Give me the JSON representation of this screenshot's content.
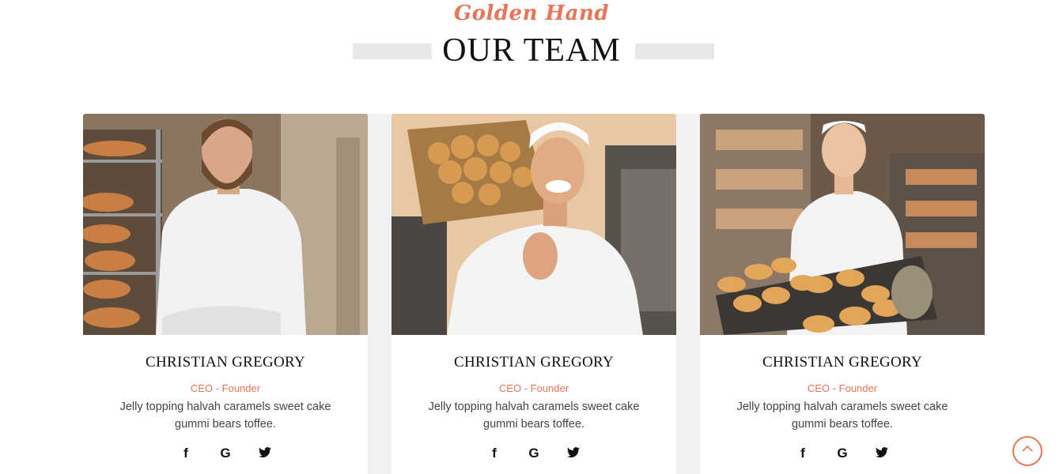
{
  "header": {
    "script_title": "Golden Hand",
    "title": "OUR TEAM"
  },
  "team": [
    {
      "name": "CHRISTIAN GREGORY",
      "role": "CEO - Founder",
      "bio": "Jelly topping halvah caramels sweet cake gummi bears toffee.",
      "photo": "bearded-baker-with-bread-racks-photo",
      "socials": [
        "facebook-icon",
        "google-icon",
        "twitter-icon"
      ]
    },
    {
      "name": "CHRISTIAN GREGORY",
      "role": "CEO - Founder",
      "bio": "Jelly topping halvah caramels sweet cake gummi bears toffee.",
      "photo": "smiling-baker-with-bread-basket-photo",
      "socials": [
        "facebook-icon",
        "google-icon",
        "twitter-icon"
      ]
    },
    {
      "name": "CHRISTIAN GREGORY",
      "role": "CEO - Founder",
      "bio": "Jelly topping halvah caramels sweet cake gummi bears toffee.",
      "photo": "female-baker-with-bun-tray-photo",
      "socials": [
        "facebook-icon",
        "google-icon",
        "twitter-icon"
      ]
    }
  ],
  "social_glyphs": {
    "facebook": "f",
    "google": "G"
  },
  "colors": {
    "accent": "#e8755a",
    "title": "#111111",
    "bar": "#e8e8e8",
    "gap": "#f1f1f1"
  },
  "scroll_top": {
    "icon": "chevron-up-icon"
  }
}
